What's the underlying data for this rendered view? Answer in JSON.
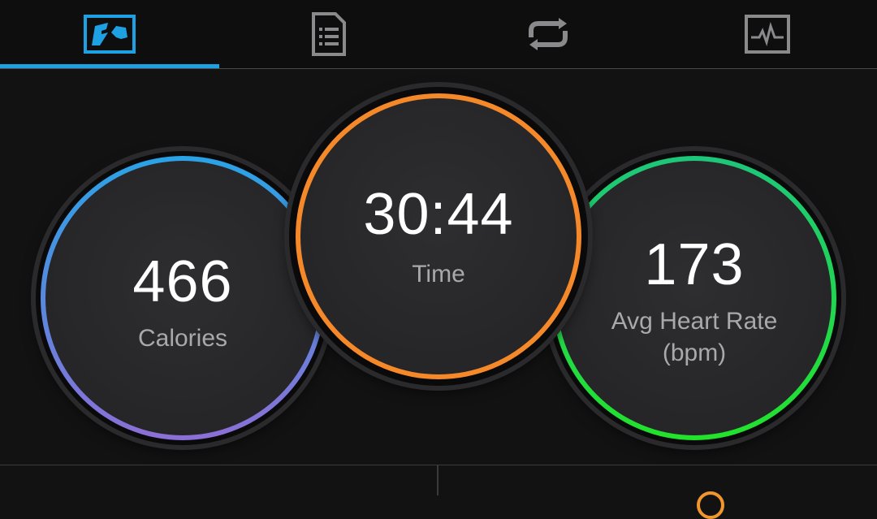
{
  "tabs": [
    {
      "name": "stats-tab",
      "icon": "stats-map-icon",
      "selected": true
    },
    {
      "name": "details-tab",
      "icon": "document-list-icon",
      "selected": false
    },
    {
      "name": "laps-tab",
      "icon": "repeat-arrows-icon",
      "selected": false
    },
    {
      "name": "charts-tab",
      "icon": "heart-graph-icon",
      "selected": false
    }
  ],
  "colors": {
    "accent": "#1ea1e2",
    "calories_ring_top": "#2aa3e6",
    "calories_ring_bottom": "#8c6fd6",
    "time_ring": "#f5892a",
    "heart_ring_top": "#1ec67a",
    "heart_ring_bottom": "#22e22c"
  },
  "stats": {
    "calories": {
      "value": "466",
      "label": "Calories"
    },
    "time": {
      "value": "30:44",
      "label": "Time"
    },
    "heart": {
      "value": "173",
      "label_line1": "Avg Heart Rate",
      "label_line2": "(bpm)"
    }
  }
}
